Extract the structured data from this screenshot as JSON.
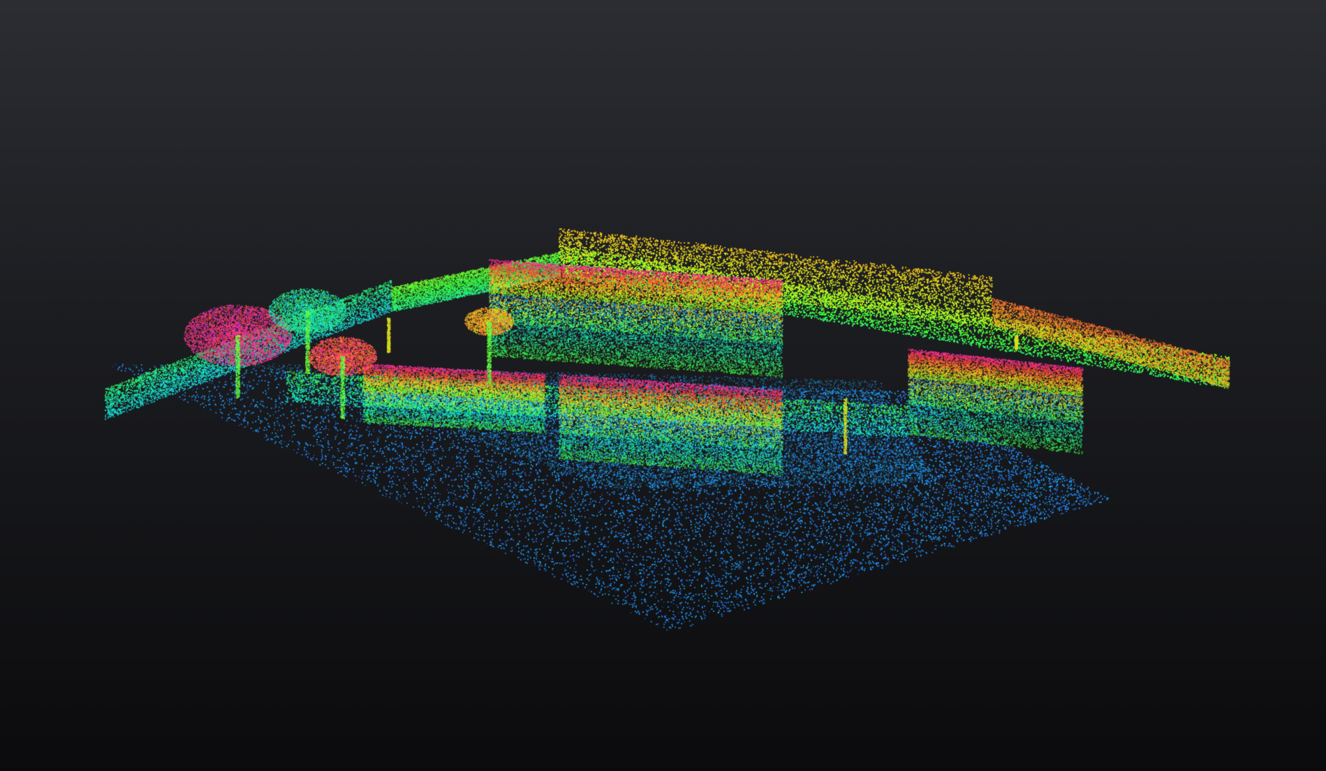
{
  "viewer": {
    "background": {
      "top": "#2c2d32",
      "bottom": "#0b0b0d"
    },
    "color_mode": "height-rainbow",
    "colormap": [
      "#2a63ff",
      "#1fb3ff",
      "#16f0c8",
      "#3cff3c",
      "#c8ff1e",
      "#ffb01e",
      "#ff3c3c",
      "#ff2ec8",
      "#8a3cff"
    ]
  },
  "scene": {
    "subject": "point-cloud",
    "objects": [
      "ground",
      "courtyard-floor",
      "perimeter-wall",
      "main-hall",
      "front-hall",
      "side-pavilion",
      "east-pavilion",
      "trees",
      "lamp-posts"
    ]
  }
}
